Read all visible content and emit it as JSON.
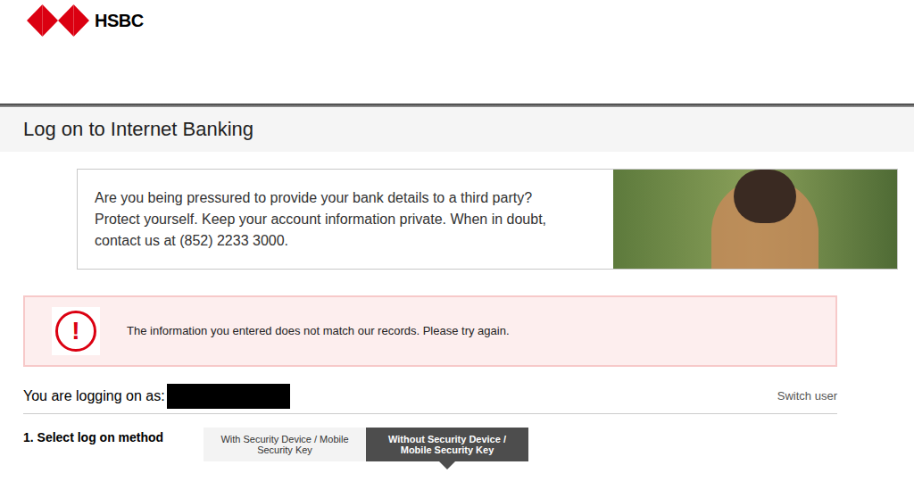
{
  "logo": {
    "text": "HSBC"
  },
  "page_title": "Log on to Internet Banking",
  "notice": {
    "lines": [
      "Are you being pressured to provide your bank details to a third party?",
      "Protect yourself. Keep your account information private. When in doubt,",
      "contact us at (852) 2233 3000."
    ]
  },
  "error": {
    "icon": "!",
    "message": "The information you entered does not match our records. Please try again."
  },
  "user": {
    "label": "You are logging on as:",
    "switch": "Switch user"
  },
  "step": {
    "label": "1. Select log on method",
    "options": [
      {
        "label": "With Security Device / Mobile Security Key",
        "selected": false
      },
      {
        "label": "Without Security Device / Mobile Security Key",
        "selected": true
      }
    ]
  }
}
